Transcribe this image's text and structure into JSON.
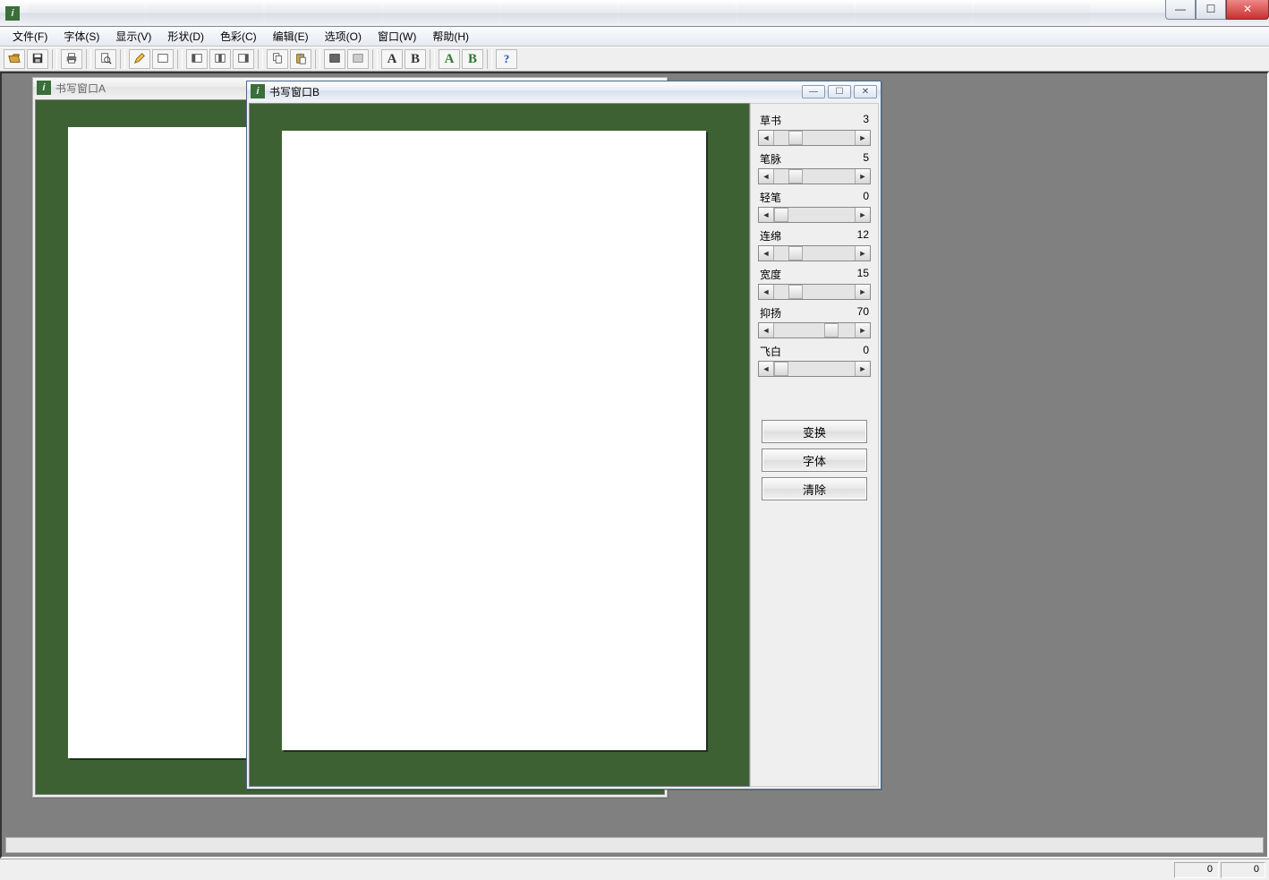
{
  "os": {
    "min_glyph": "—",
    "max_glyph": "☐",
    "close_glyph": "✕"
  },
  "menu": {
    "file": "文件(F)",
    "font": "字体(S)",
    "view": "显示(V)",
    "shape": "形状(D)",
    "color": "色彩(C)",
    "edit": "编辑(E)",
    "options": "选项(O)",
    "window": "窗口(W)",
    "help": "帮助(H)"
  },
  "toolbar": {
    "open": "open-icon",
    "save": "save-icon",
    "print": "print-icon",
    "preview": "preview-icon",
    "pencil": "pencil-icon",
    "eraser": "eraser-icon",
    "panel_left": "panel-left-icon",
    "panel_center": "panel-center-icon",
    "panel_right": "panel-right-icon",
    "copy": "copy-icon",
    "paste": "paste-icon",
    "layer1": "layer1-icon",
    "layer2": "layer2-icon",
    "letter_a_black": "A",
    "letter_b_black": "B",
    "letter_a_green": "A",
    "letter_b_green": "B",
    "help": "help-icon"
  },
  "windows": {
    "a": {
      "title": "书写窗口A"
    },
    "b": {
      "title": "书写窗口B",
      "sliders": [
        {
          "label": "草书",
          "value": 3,
          "pct": 18
        },
        {
          "label": "笔脉",
          "value": 5,
          "pct": 18
        },
        {
          "label": "轻笔",
          "value": 0,
          "pct": 0
        },
        {
          "label": "连绵",
          "value": 12,
          "pct": 18
        },
        {
          "label": "宽度",
          "value": 15,
          "pct": 18
        },
        {
          "label": "抑扬",
          "value": 70,
          "pct": 62
        },
        {
          "label": "飞白",
          "value": 0,
          "pct": 0
        }
      ],
      "buttons": {
        "transform": "变换",
        "font": "字体",
        "clear": "清除"
      }
    }
  },
  "status": {
    "left_num": "0",
    "right_num": "0"
  }
}
